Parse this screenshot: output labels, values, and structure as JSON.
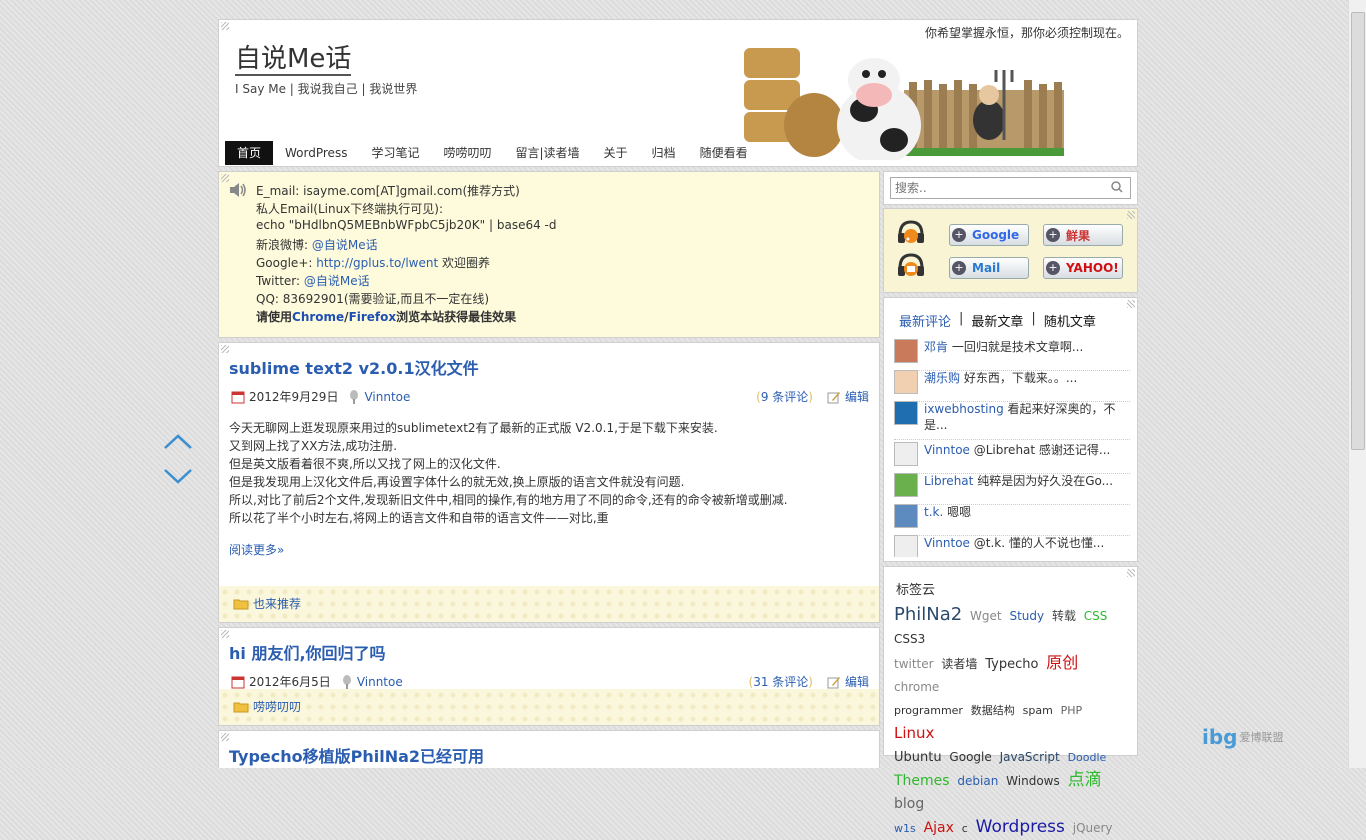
{
  "site": {
    "title": "自说Me话",
    "description": "I Say Me | 我说我自己 | 我说世界",
    "motto": "你希望掌握永恒，那你必须控制现在。"
  },
  "nav": [
    "首页",
    "WordPress",
    "学习笔记",
    "唠唠叨叨",
    "留言|读者墙",
    "关于",
    "归档",
    "随便看看"
  ],
  "notice": {
    "email": "E_mail: isayme.com[AT]gmail.com(推荐方式)",
    "private_email": "私人Email(Linux下终端执行可见):",
    "echo_cmd": "echo \"bHdlbnQ5MEBnbWFpbC5jb20K\" | base64 -d",
    "weibo_label": "新浪微博: ",
    "weibo_link": "@自说Me话",
    "gplus_label": "Google+: ",
    "gplus_link": "http://gplus.to/lwent",
    "gplus_after": " 欢迎圈养",
    "twitter_label": "Twitter: ",
    "twitter_link": "@自说Me话",
    "qq": "QQ: 83692901(需要验证,而且不一定在线)",
    "strong_1": "请使用",
    "strong_chrome": "Chrome",
    "strong_slash": "/",
    "strong_firefox": "Firefox",
    "strong_2": "浏览本站获得最佳效果"
  },
  "posts": [
    {
      "title": "sublime text2 v2.0.1汉化文件",
      "date": "2012年9月29日",
      "author": "Vinntoe",
      "comments": "9 条评论",
      "edit": "编辑",
      "body": [
        "今天无聊网上逛发现原来用过的sublimetext2有了最新的正式版 V2.0.1,于是下载下来安装.",
        "又到网上找了XX方法,成功注册.",
        "但是英文版看着很不爽,所以又找了网上的汉化文件.",
        "但是我发现用上汉化文件后,再设置字体什么的就无效,换上原版的语言文件就没有问题.",
        "所以,对比了前后2个文件,发现新旧文件中,相同的操作,有的地方用了不同的命令,还有的命令被新增或删减.",
        "所以花了半个小时左右,将网上的语言文件和自带的语言文件——对比,重"
      ],
      "read_more": "阅读更多»",
      "category": "也来推荐"
    },
    {
      "title": "hi 朋友们,你回归了吗",
      "date": "2012年6月5日",
      "author": "Vinntoe",
      "comments": "31 条评论",
      "edit": "编辑",
      "category": "唠唠叨叨"
    },
    {
      "title": "Typecho移植版PhilNa2已经可用"
    }
  ],
  "search": {
    "placeholder": "搜索.."
  },
  "subscribe": {
    "google": "Google",
    "xianguo": "鲜果",
    "mail": "Mail",
    "yahoo": "YAHOO!"
  },
  "tabs": {
    "comments": "最新评论",
    "posts": "最新文章",
    "random": "随机文章",
    "sep": "|"
  },
  "recent_comments": [
    {
      "name": "邓肯",
      "text": "一回归就是技术文章啊..."
    },
    {
      "name": "潮乐购",
      "text": "好东西，下载来。。..."
    },
    {
      "name": "ixwebhosting",
      "text": "看起来好深奥的，不是..."
    },
    {
      "name": "Vinntoe",
      "text": "@Librehat 感谢还记得..."
    },
    {
      "name": "Librehat",
      "text": "纯粹是因为好久没在Go..."
    },
    {
      "name": "t.k.",
      "text": "嗯嗯"
    },
    {
      "name": "Vinntoe",
      "text": "@t.k. 懂的人不说也懂..."
    }
  ],
  "tagcloud": {
    "title": "标签云",
    "tags": [
      {
        "t": "PhilNa2",
        "c": "#2b4a6b"
      },
      {
        "t": "Wget",
        "c": "#888888"
      },
      {
        "t": "Study",
        "c": "#2a5db0"
      },
      {
        "t": "转载",
        "c": "#444444"
      },
      {
        "t": "CSS",
        "c": "#2eb82e"
      },
      {
        "t": "CSS3",
        "c": "#333333"
      },
      {
        "t": "twitter",
        "c": "#888888"
      },
      {
        "t": "读者墙",
        "c": "#333333"
      },
      {
        "t": "Typecho",
        "c": "#333333"
      },
      {
        "t": "原创",
        "c": "#d01010"
      },
      {
        "t": "chrome",
        "c": "#888888"
      },
      {
        "t": "programmer",
        "c": "#333333"
      },
      {
        "t": "数据结构",
        "c": "#333333"
      },
      {
        "t": "spam",
        "c": "#333333"
      },
      {
        "t": "PHP",
        "c": "#666666"
      },
      {
        "t": "Linux",
        "c": "#d01010"
      },
      {
        "t": "Ubuntu",
        "c": "#333333"
      },
      {
        "t": "Google",
        "c": "#333333"
      },
      {
        "t": "JavaScript",
        "c": "#2b4a6b"
      },
      {
        "t": "Doodle",
        "c": "#2a5db0"
      },
      {
        "t": "Themes",
        "c": "#2eb82e"
      },
      {
        "t": "debian",
        "c": "#2a5db0"
      },
      {
        "t": "Windows",
        "c": "#333333"
      },
      {
        "t": "点滴",
        "c": "#2eb82e"
      },
      {
        "t": "blog",
        "c": "#666666"
      },
      {
        "t": "w1s",
        "c": "#2a5db0"
      },
      {
        "t": "Ajax",
        "c": "#d01010"
      },
      {
        "t": "c",
        "c": "#333333"
      },
      {
        "t": "Wordpress",
        "c": "#1a1aa6"
      },
      {
        "t": "jQuery",
        "c": "#888888"
      }
    ]
  },
  "watermark": {
    "logo": "ibg",
    "text": "爱博联盟"
  },
  "colors": {
    "link": "#2a5db0",
    "notice_bg": "#fdfbdc",
    "alert_red": "#d00000",
    "nav_active": "#111111"
  }
}
